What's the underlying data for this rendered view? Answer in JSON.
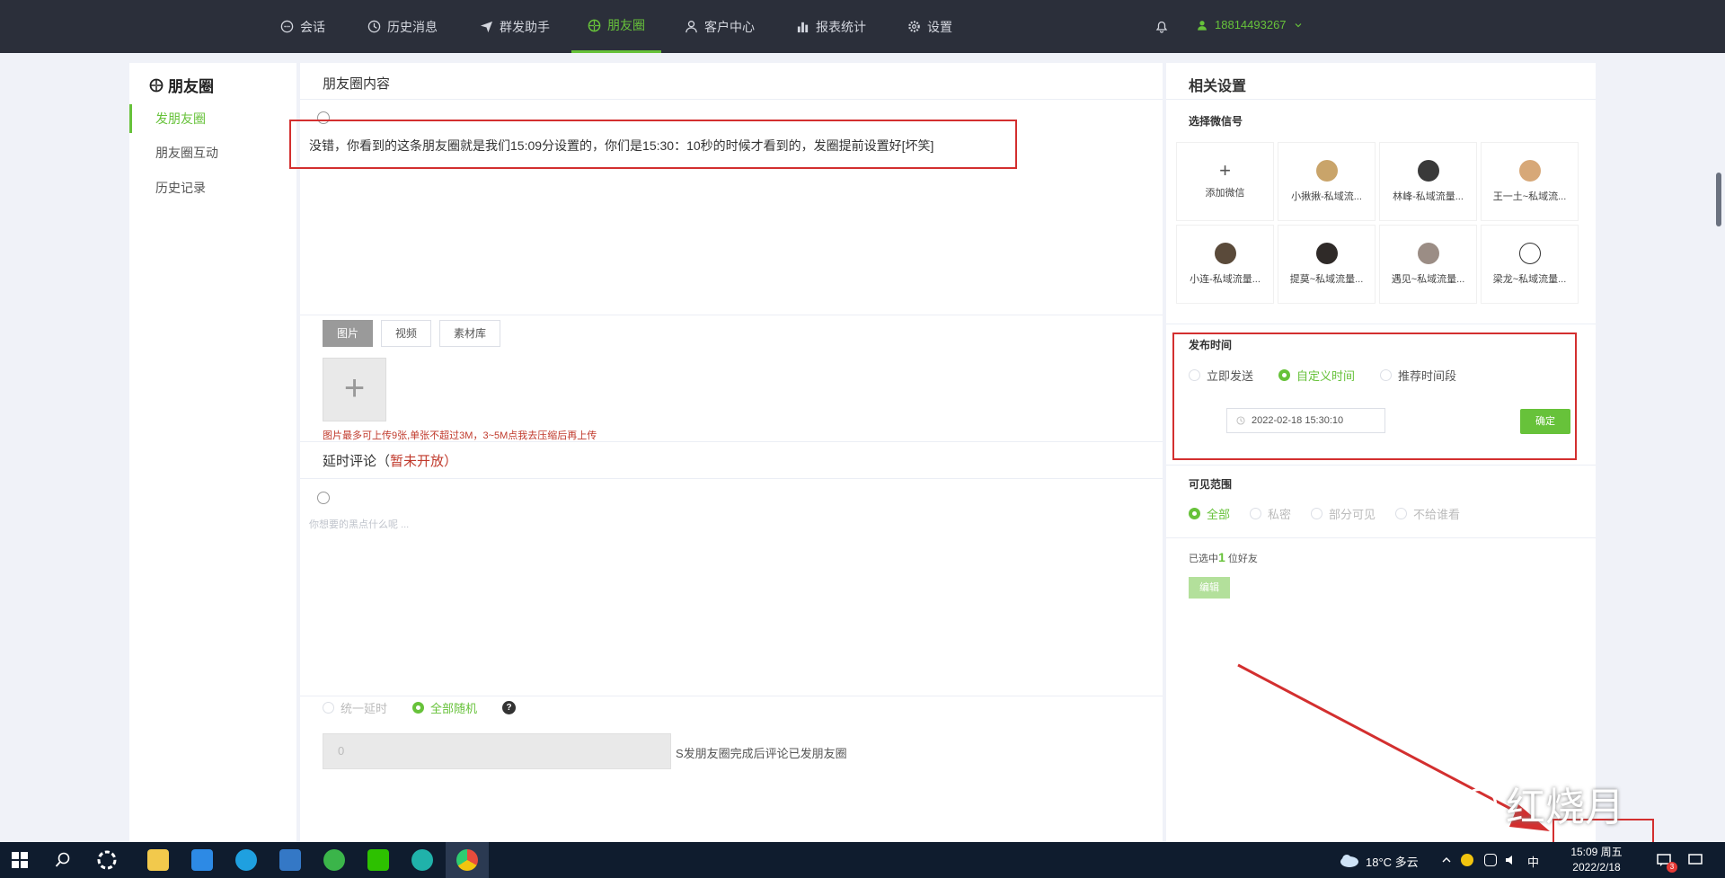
{
  "nav": {
    "items": [
      {
        "label": "会话",
        "icon": "chat-icon"
      },
      {
        "label": "历史消息",
        "icon": "clock-icon"
      },
      {
        "label": "群发助手",
        "icon": "send-icon"
      },
      {
        "label": "朋友圈",
        "icon": "moments-icon",
        "active": true
      },
      {
        "label": "客户中心",
        "icon": "user-icon"
      },
      {
        "label": "报表统计",
        "icon": "chart-icon"
      },
      {
        "label": "设置",
        "icon": "gear-icon"
      }
    ],
    "user_phone": "18814493267"
  },
  "sidebar": {
    "title": "朋友圈",
    "items": [
      {
        "label": "发朋友圈",
        "active": true
      },
      {
        "label": "朋友圈互动"
      },
      {
        "label": "历史记录"
      }
    ]
  },
  "main": {
    "title": "朋友圈内容",
    "post_text": "没错，你看到的这条朋友圈就是我们15:09分设置的，你们是15:30：10秒的时候才看到的，发圈提前设置好[坏笑]",
    "tabs": [
      "图片",
      "视频",
      "素材库"
    ],
    "upload_tip": "图片最多可上传9张,单张不超过3M，3~5M点我去压缩后再上传",
    "delay_comment_title": "延时评论（",
    "delay_comment_status": "暂未开放",
    "delay_comment_close": "）",
    "comment_placeholder": "你想要的黑点什么呢 ...",
    "delay_options": [
      {
        "label": "统一延时",
        "selected": false
      },
      {
        "label": "全部随机",
        "selected": true
      }
    ],
    "delay_value": "0",
    "delay_suffix": "S发朋友圈完成后评论已发朋友圈"
  },
  "right": {
    "title": "相关设置",
    "wechat_section": "选择微信号",
    "add_wechat": "添加微信",
    "accounts": [
      {
        "name": "小揪揪-私域流...",
        "color": "#c9a46a"
      },
      {
        "name": "林峰-私域流量...",
        "color": "#3a3a3a"
      },
      {
        "name": "王一土~私域流...",
        "color": "#d7a878"
      },
      {
        "name": "小连-私域流量...",
        "color": "#5a4a3a"
      },
      {
        "name": "提莫~私域流量...",
        "color": "#2f2a28"
      },
      {
        "name": "遇见~私域流量...",
        "color": "#9b8d85"
      },
      {
        "name": "梁龙~私域流量...",
        "color": "#ffffff"
      }
    ],
    "publish_section": "发布时间",
    "publish_options": [
      {
        "label": "立即发送",
        "selected": false
      },
      {
        "label": "自定义时间",
        "selected": true
      },
      {
        "label": "推荐时间段",
        "selected": false
      }
    ],
    "publish_datetime": "2022-02-18 15:30:10",
    "confirm_label": "确定",
    "visibility_section": "可见范围",
    "visibility_options": [
      {
        "label": "全部",
        "selected": true
      },
      {
        "label": "私密",
        "selected": false
      },
      {
        "label": "部分可见",
        "selected": false
      },
      {
        "label": "不给谁看",
        "selected": false
      }
    ],
    "selected_prefix": "已选中",
    "selected_count": "1",
    "selected_suffix": " 位好友",
    "edit_label": "编辑"
  },
  "watermark": "红烧月",
  "taskbar": {
    "weather": "18°C 多云",
    "ime": "中",
    "time": "15:09 周五",
    "date": "2022/2/18",
    "badge": "3"
  }
}
